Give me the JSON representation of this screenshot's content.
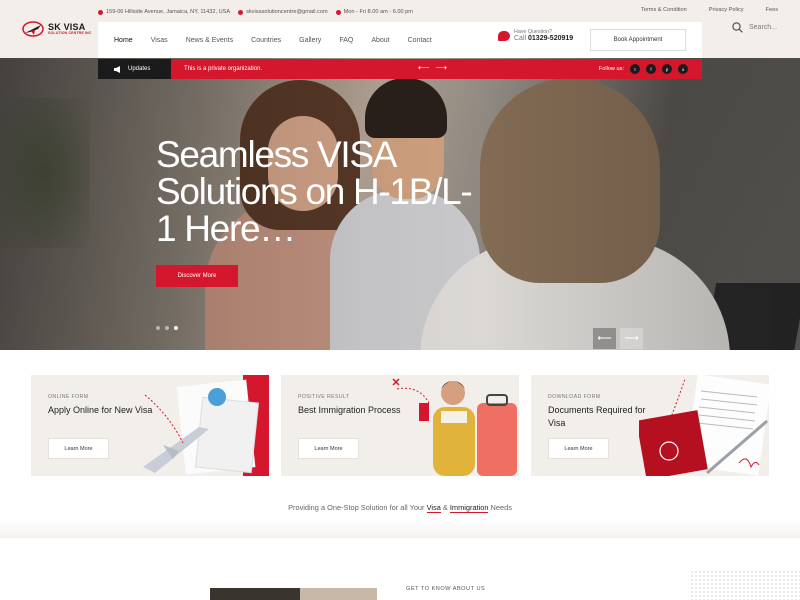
{
  "brand": {
    "name": "SK VISA",
    "subtitle": "SOLUTION CENTRE INC",
    "accent": "#d5172e"
  },
  "topbar": {
    "address": "159-06 Hillside Avenue, Jamaica, NY, 11432, USA",
    "email": "skvisasolutioncentre@gmail.com",
    "hours": "Mon - Fri 8.00 am - 6.00 pm",
    "links": [
      "Terms & Condition",
      "Privacy Policy",
      "Fees"
    ]
  },
  "nav": {
    "items": [
      "Home",
      "Visas",
      "News & Events",
      "Countries",
      "Gallery",
      "FAQ",
      "About",
      "Contact"
    ],
    "active": "Home",
    "question_label": "Have Question?",
    "call_prefix": "Call",
    "phone": "01329-520919",
    "appointment_button": "Book Appointment"
  },
  "search": {
    "placeholder": "Search..."
  },
  "updates": {
    "label": "Updates",
    "text": "This is a private organization.",
    "prev": "⟵",
    "next": "⟶",
    "follow_label": "Follow us:",
    "socials": [
      "twitter-icon",
      "facebook-icon",
      "pinterest-icon",
      "instagram-icon"
    ],
    "social_glyphs": [
      "t",
      "f",
      "p",
      "o"
    ]
  },
  "hero": {
    "title": "Seamless VISA Solutions on H-1B/L-1 Here…",
    "button": "Discover More",
    "slides": 3,
    "active_slide": 3,
    "prev_arrow": "⟵",
    "next_arrow": "⟶"
  },
  "cards": [
    {
      "eyebrow": "ONLINE FORM",
      "title": "Apply Online for New Visa",
      "button": "Learn More"
    },
    {
      "eyebrow": "POSITIVE RESULT",
      "title": "Best Immigration Process",
      "button": "Learn More"
    },
    {
      "eyebrow": "DOWNLOAD FORM",
      "title": "Documents Required for Visa",
      "button": "Learn More"
    }
  ],
  "tagline": {
    "before": "Providing a One-Stop Solution for all Your ",
    "visa": "Visa",
    "amp": " & ",
    "immigration": "Immigration",
    "after": " Needs"
  },
  "about": {
    "eyebrow": "GET TO KNOW ABOUT US"
  }
}
